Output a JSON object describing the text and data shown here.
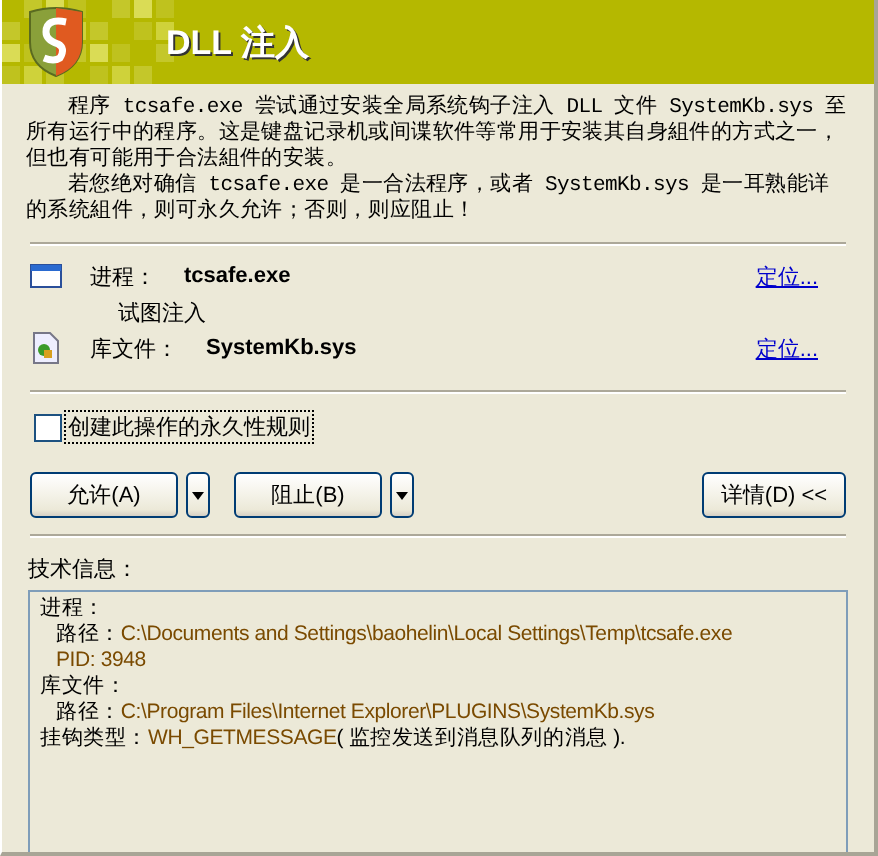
{
  "window": {
    "title": "DLL 注入"
  },
  "message": [
    "程序 tcsafe.exe 尝试通过安装全局系统钩子注入 DLL 文件 SystemKb.sys 至所有运行中的程序。这是键盘记录机或间谍软件等常用于安装其自身組件的方式之一，但也有可能用于合法組件的安装。",
    "若您绝对确信 tcsafe.exe 是一合法程序，或者 SystemKb.sys 是一耳熟能详的系统組件，则可永久允许；否则，则应阻止！"
  ],
  "objects": [
    {
      "kind": "process",
      "label": "进程：",
      "value": "tcsafe.exe",
      "link": "定位...",
      "note": "试图注入"
    },
    {
      "kind": "library",
      "label": "库文件：",
      "value": "SystemKb.sys",
      "link": "定位..."
    }
  ],
  "rule_checkbox": {
    "label": "创建此操作的永久性规则",
    "checked": false
  },
  "buttons": [
    {
      "label": "允许(A)",
      "menu": true
    },
    {
      "label": "阻止(B)",
      "menu": true
    }
  ],
  "details_button": {
    "label": "详情(D) <<"
  },
  "tech_info": {
    "title": "技术信息：",
    "items": [
      {
        "label": "进程：",
        "children": [
          {
            "label": "路径：",
            "value": "C:\\Documents and Settings\\baohelin\\Local Settings\\Temp\\tcsafe.exe"
          },
          {
            "value": "PID: 3948"
          }
        ]
      },
      {
        "label": "库文件：",
        "children": [
          {
            "label": "路径：",
            "value": "C:\\Program Files\\Internet Explorer\\PLUGINS\\SystemKb.sys"
          }
        ]
      },
      {
        "label": "挂钩类型：",
        "value": "WH_GETMESSAGE",
        "note": "( 监控发送到消息队列的消息 )."
      }
    ]
  }
}
